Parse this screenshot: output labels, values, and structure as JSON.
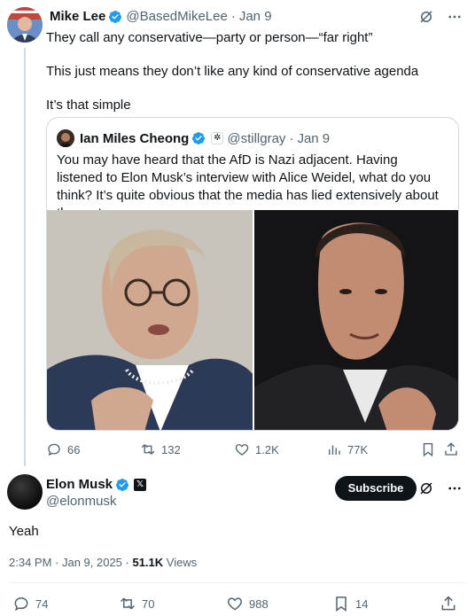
{
  "parent": {
    "name": "Mike Lee",
    "handle": "@BasedMikeLee",
    "sep": "·",
    "date": "Jan 9",
    "lines": [
      "They call any conservative—party or person—“far right”",
      "This just means they don’t like any kind of conservative agenda",
      "It’s that simple"
    ]
  },
  "quote": {
    "name": "Ian Miles Cheong",
    "handle": "@stillgray",
    "sep": "·",
    "date": "Jan 9",
    "text": "You may have heard that the AfD is Nazi adjacent. Having listened to Elon Musk’s interview with Alice Weidel, what do you think? It’s quite obvious that the media has lied extensively about the party."
  },
  "parent_actions": {
    "replies": "66",
    "reposts": "132",
    "likes": "1.2K",
    "views": "77K"
  },
  "main": {
    "name": "Elon Musk",
    "x_badge": "𝕏",
    "handle": "@elonmusk",
    "subscribe_label": "Subscribe",
    "text": "Yeah",
    "time": "2:34 PM · Jan 9, 2025 · ",
    "views_count": "51.1K",
    "views_label": " Views"
  },
  "main_actions": {
    "replies": "74",
    "reposts": "70",
    "likes": "988",
    "bookmarks": "14"
  },
  "icons": {
    "verified": "verified-badge-icon",
    "grok": "grok-icon",
    "more": "more-icon",
    "reply": "reply-icon",
    "repost": "repost-icon",
    "like": "like-icon",
    "views": "views-icon",
    "bookmark": "bookmark-icon",
    "share": "share-icon"
  },
  "colors": {
    "verified": "#1d9bf0",
    "text": "#0f1419",
    "secondary": "#536471"
  }
}
